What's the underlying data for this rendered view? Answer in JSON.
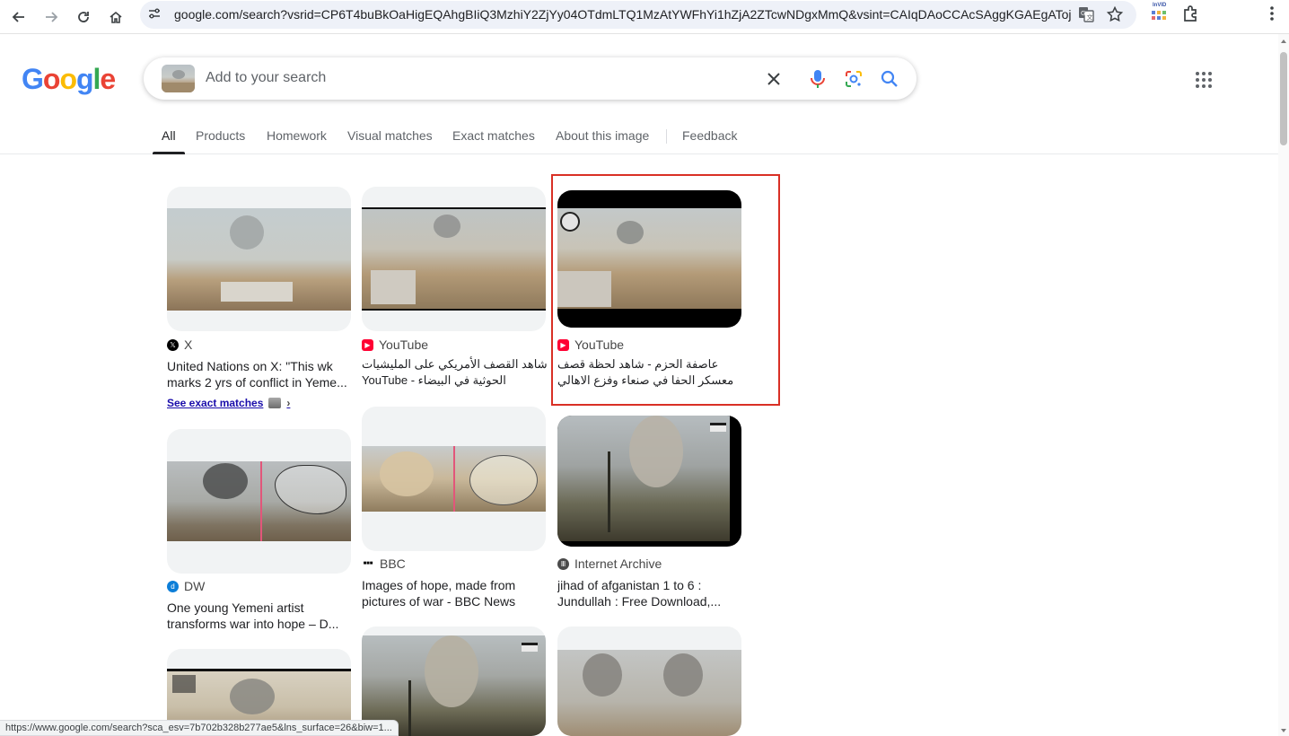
{
  "browser": {
    "url": "google.com/search?vsrid=CP6T4buBkOaHigEQAhgBIiQ3MzhiY2ZjYy04OTdmLTQ1MzAtYWFhYi1hZjA2ZTcwNDgxMmQ&vsint=CAIqDAoCCAcSAggKGAEgATojCh...",
    "extension_label": "InVID",
    "status_url": "https://www.google.com/search?sca_esv=7b702b328b277ae5&lns_surface=26&biw=1..."
  },
  "header": {
    "logo": [
      "G",
      "o",
      "o",
      "g",
      "l",
      "e"
    ],
    "logo_colors": [
      "#4285F4",
      "#EA4335",
      "#FBBC05",
      "#4285F4",
      "#34A853",
      "#EA4335"
    ],
    "search_placeholder": "Add to your search"
  },
  "tabs": [
    {
      "label": "All",
      "active": true
    },
    {
      "label": "Products"
    },
    {
      "label": "Homework"
    },
    {
      "label": "Visual matches"
    },
    {
      "label": "Exact matches"
    },
    {
      "label": "About this image"
    },
    {
      "label": "Feedback"
    }
  ],
  "results": [
    {
      "source": "X",
      "title": "United Nations on X: \"This wk marks 2 yrs of conflict in Yeme...",
      "exact_matches": "See exact matches"
    },
    {
      "source": "YouTube",
      "title": "شاهد القصف الأمريكي على المليشيات الحوثية في البيضاء - YouTube"
    },
    {
      "source": "YouTube",
      "title": "عاصفة الحزم - شاهد لحظة قصف معسكر الحفا في صنعاء وفزع الاهالي من صوت..."
    },
    {
      "source": "DW",
      "title": "One young Yemeni artist transforms war into hope – D..."
    },
    {
      "source": "BBC",
      "title": "Images of hope, made from pictures of war - BBC News"
    },
    {
      "source": "Internet Archive",
      "title": "jihad of afganistan 1 to 6 : Jundullah : Free Download,..."
    }
  ],
  "colors": {
    "youtube": "#FF0033",
    "highlight": "#D93025",
    "link": "#1A0DAB"
  }
}
